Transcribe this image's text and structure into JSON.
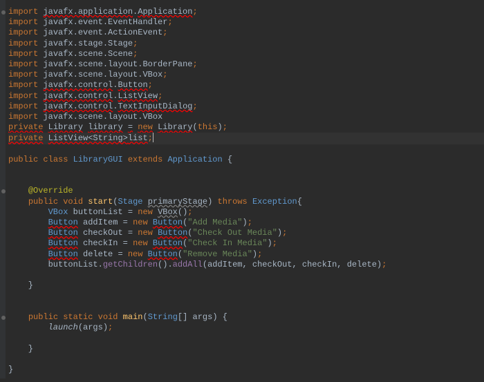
{
  "chart_data": null,
  "code": {
    "imports": [
      {
        "k": "import",
        "p1": "javafx.application",
        "c": "Application",
        "err": true
      },
      {
        "k": "import",
        "p1": "javafx.event",
        "c": "EventHandler",
        "err": false
      },
      {
        "k": "import",
        "p1": "javafx.event",
        "c": "ActionEvent",
        "err": false
      },
      {
        "k": "import",
        "p1": "javafx.stage",
        "c": "Stage",
        "err": false
      },
      {
        "k": "import",
        "p1": "javafx.scene",
        "c": "Scene",
        "err": false
      },
      {
        "k": "import",
        "p1": "javafx.scene.layout",
        "c": "BorderPane",
        "err": false
      },
      {
        "k": "import",
        "p1": "javafx.scene.layout",
        "c": "VBox",
        "err": false
      },
      {
        "k": "import",
        "p1": "javafx.control",
        "c": "Button",
        "err": true
      },
      {
        "k": "import",
        "p1": "javafx.control",
        "c": "ListView",
        "err": true
      },
      {
        "k": "import",
        "p1": "javafx.control",
        "c": "TextInputDialog",
        "err": true
      },
      {
        "k": "import",
        "p1": "javafx.scene.layout",
        "c": "VBox",
        "err": false,
        "nosemi": true
      }
    ],
    "field1": {
      "mod": "private",
      "type": "Library",
      "name": "library",
      "eq": "=",
      "newkw": "new",
      "ctor": "Library",
      "arg": "this"
    },
    "field2": {
      "mod": "private",
      "type": "ListView<String>",
      "name": "list"
    },
    "classdecl": {
      "pub": "public",
      "cls": "class",
      "name": "LibraryGUI",
      "ext": "extends",
      "sup": "Application",
      "brace": "{"
    },
    "override": "@Override",
    "startSig": {
      "pub": "public",
      "void": "void",
      "name": "start",
      "ptype": "Stage",
      "pname": "primaryStage",
      "thr": "throws",
      "exc": "Exception"
    },
    "vboxLine": {
      "type": "VBox",
      "name": "buttonList",
      "eq": "=",
      "newkw": "new",
      "ctor": "VBox"
    },
    "btn1": {
      "type": "Button",
      "name": "addItem",
      "eq": "=",
      "newkw": "new",
      "ctor": "Button",
      "arg": "\"Add Media\""
    },
    "btn2": {
      "type": "Button",
      "name": "checkOut",
      "eq": "=",
      "newkw": "new",
      "ctor": "Button",
      "arg": "\"Check Out Media\""
    },
    "btn3": {
      "type": "Button",
      "name": "checkIn",
      "eq": "=",
      "newkw": "new",
      "ctor": "Button",
      "arg": "\"Check In Media\""
    },
    "btn4": {
      "type": "Button",
      "name": "delete",
      "eq": "=",
      "newkw": "new",
      "ctor": "Button",
      "arg": "\"Remove Media\""
    },
    "addAll": {
      "obj": "buttonList",
      "m1": "getChildren",
      "m2": "addAll",
      "args": "addItem, checkOut, checkIn, delete"
    },
    "mainSig": {
      "pub": "public",
      "stat": "static",
      "void": "void",
      "name": "main",
      "ptype": "String",
      "pname": "args"
    },
    "launchCall": {
      "fn": "launch",
      "arg": "args"
    }
  }
}
